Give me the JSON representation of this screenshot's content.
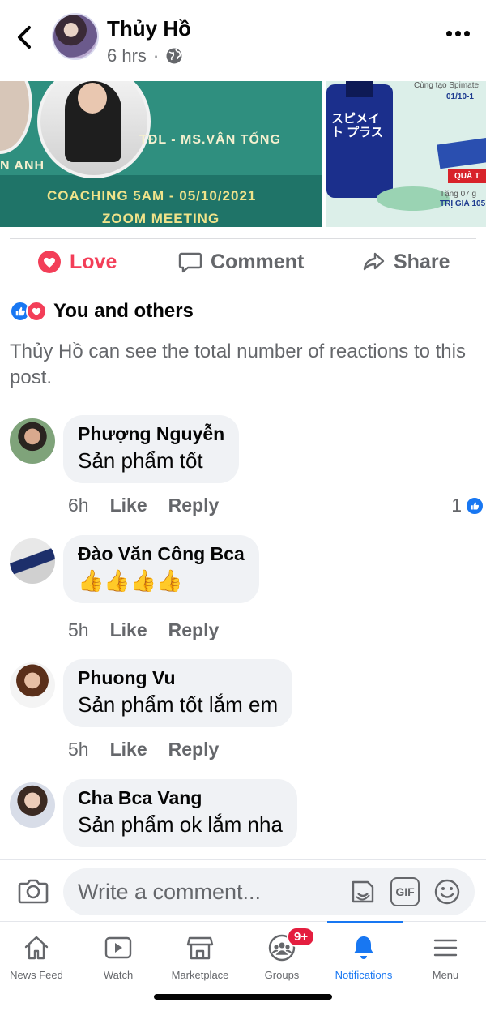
{
  "header": {
    "poster_name": "Thủy Hồ",
    "time": "6 hrs",
    "dot": "·"
  },
  "images": {
    "left_labels": [
      "TĐL - MS.VÂN TỐNG",
      "N ANH",
      "COACHING 5AM - 05/10/2021",
      "ZOOM MEETING"
    ],
    "right_texts": {
      "top": "Cùng tạo Spimate",
      "date": "01/10-1",
      "bottle": "スピメイト プラス",
      "gift": "QUÀ T",
      "note": "Tặng 07 g",
      "value": "TRỊ GIÁ 105"
    }
  },
  "actions": {
    "love": "Love",
    "comment": "Comment",
    "share": "Share"
  },
  "reactions": {
    "text": "You and others",
    "notice": "Thủy Hồ can see the total number of reactions to this post."
  },
  "comments": [
    {
      "name": "Phượng Nguyễn",
      "text": "Sản phẩm tốt",
      "time": "6h",
      "like": "Like",
      "reply": "Reply",
      "likes": "1"
    },
    {
      "name": "Đào Văn Công Bca",
      "text": "👍👍👍👍",
      "time": "5h",
      "like": "Like",
      "reply": "Reply"
    },
    {
      "name": "Phuong Vu",
      "text": "Sản phẩm tốt lắm em",
      "time": "5h",
      "like": "Like",
      "reply": "Reply"
    },
    {
      "name": "Cha Bca Vang",
      "text": "Sản phẩm ok lắm nha"
    }
  ],
  "composer": {
    "placeholder": "Write a comment...",
    "gif": "GIF"
  },
  "nav": {
    "items": [
      {
        "label": "News Feed"
      },
      {
        "label": "Watch"
      },
      {
        "label": "Marketplace"
      },
      {
        "label": "Groups",
        "badge": "9+"
      },
      {
        "label": "Notifications"
      },
      {
        "label": "Menu"
      }
    ]
  },
  "colors": {
    "brand_blue": "#1877f2",
    "love_red": "#f33e58",
    "badge_red": "#e41e3f",
    "secondary_text": "#65676b"
  }
}
